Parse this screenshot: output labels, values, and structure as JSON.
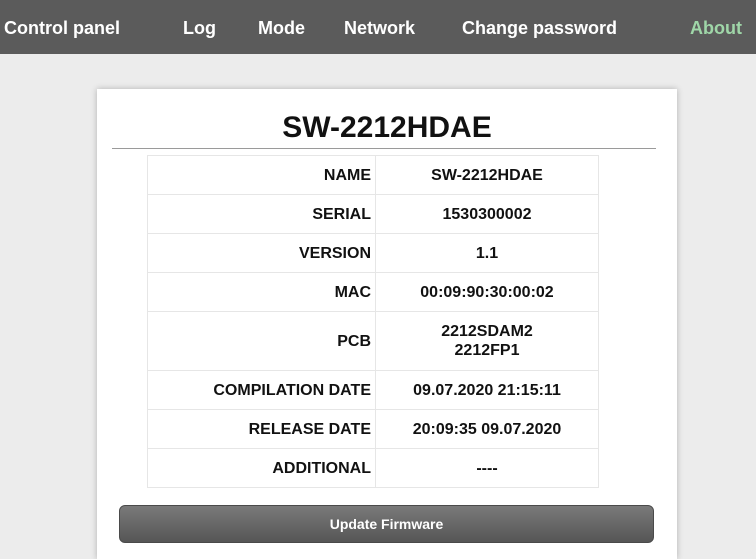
{
  "nav": {
    "control_panel": "Control panel",
    "log": "Log",
    "mode": "Mode",
    "network": "Network",
    "change_password": "Change password",
    "about": "About",
    "active": "About"
  },
  "card": {
    "title": "SW-2212HDAE",
    "rows": [
      {
        "label": "NAME",
        "value": "SW-2212HDAE"
      },
      {
        "label": "SERIAL",
        "value": "1530300002"
      },
      {
        "label": "VERSION",
        "value": "1.1"
      },
      {
        "label": "MAC",
        "value": "00:09:90:30:00:02"
      },
      {
        "label": "PCB",
        "value_lines": [
          "2212SDAM2",
          "2212FP1"
        ]
      },
      {
        "label": "COMPILATION DATE",
        "value": "09.07.2020 21:15:11"
      },
      {
        "label": "RELEASE DATE",
        "value": "20:09:35 09.07.2020"
      },
      {
        "label": "ADDITIONAL",
        "value": "----"
      }
    ],
    "update_button_label": "Update Firmware"
  },
  "colors": {
    "nav_background": "#5b5b5b",
    "nav_active": "#9fd6a8",
    "page_background": "#ececec",
    "button_background": "#666666"
  }
}
